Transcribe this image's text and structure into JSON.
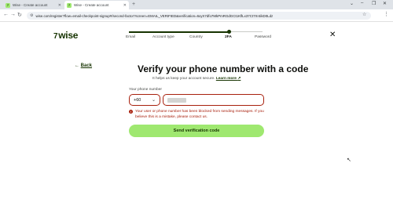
{
  "browser": {
    "tabs": [
      {
        "label": "Wise - Create account",
        "active": false,
        "icon": "wise-favicon"
      },
      {
        "label": "Wise - Create account",
        "active": true,
        "icon": "wise-favicon"
      }
    ],
    "new_tab": "+",
    "url": "wise.com/register?flow=email-checkpoint-signup#/second-factor?screen=EMAIL_VERIFIED&verification=6xyX7dfo7MkPmRGdGCt1KflLx37Ct7Xr4ikD0Ldz",
    "window_controls": {
      "menu": "⌄",
      "minimize": "–",
      "restore": "❐",
      "close": "✕"
    }
  },
  "header": {
    "logo": "wise",
    "steps": [
      {
        "label": "Email",
        "active": false
      },
      {
        "label": "Account type",
        "active": false
      },
      {
        "label": "Country",
        "active": false
      },
      {
        "label": "2FA",
        "active": true
      },
      {
        "label": "Password",
        "active": false
      }
    ],
    "progress_fraction": 0.75
  },
  "main": {
    "back_label": "Back",
    "title": "Verify your phone number with a code",
    "subtitle": "It helps us keep your account secure.",
    "learn_more": "Learn more",
    "phone_label": "Your phone number",
    "country_code": "+60",
    "phone_value": "",
    "error_message": "Your user or phone number has been blocked from sending messages. If you believe this is a mistake, please contact us.",
    "send_button": "Send verification code"
  },
  "colors": {
    "brand_green": "#9fe870",
    "forest": "#163300",
    "error_red": "#a8200d"
  }
}
